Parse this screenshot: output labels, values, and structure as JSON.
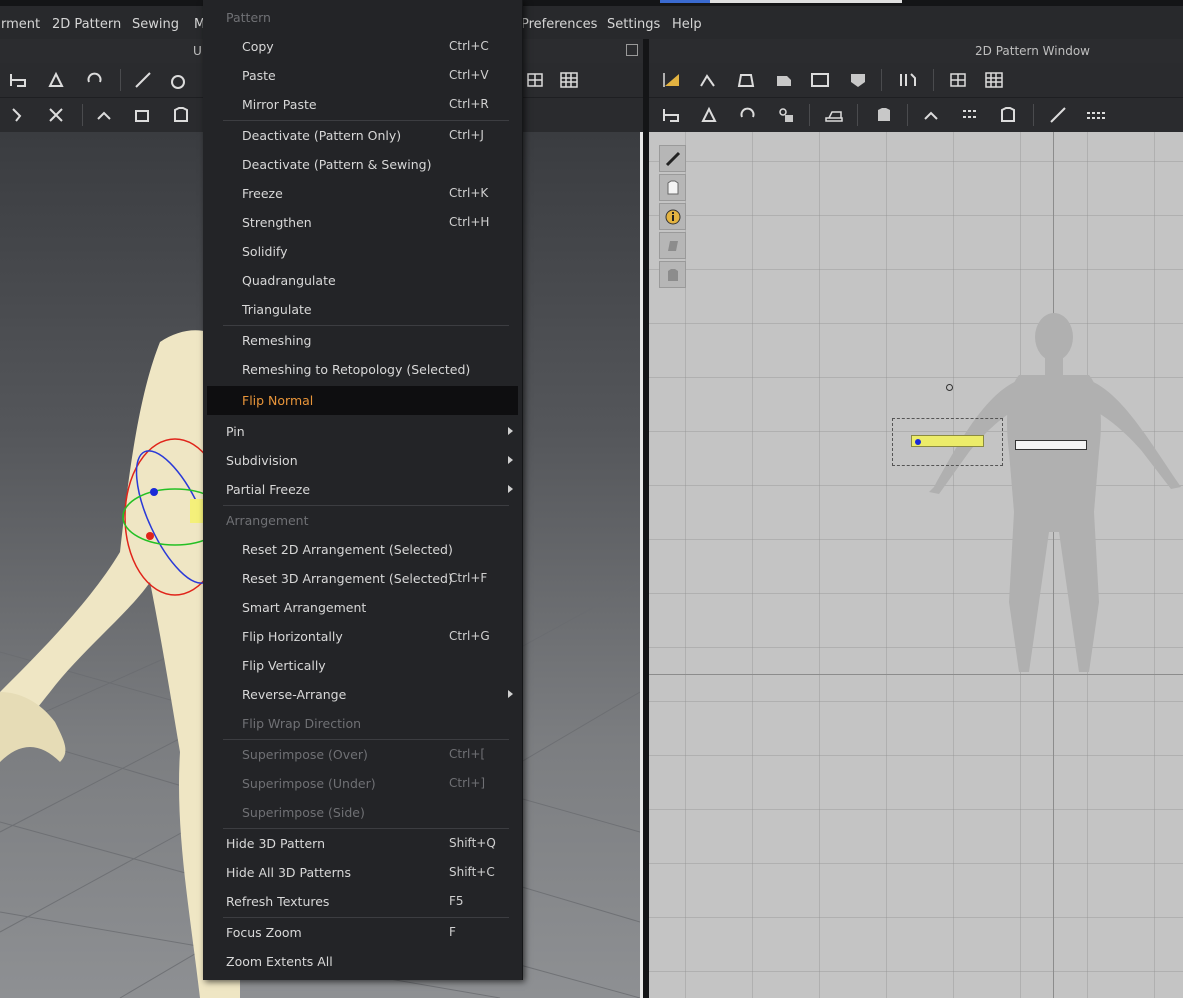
{
  "menubar": {
    "items": [
      "rment",
      "2D Pattern",
      "Sewing",
      "M",
      "Preferences",
      "Settings",
      "Help"
    ]
  },
  "panel_headers": {
    "left_title": "U",
    "right_title": "2D Pattern Window"
  },
  "context_menu": {
    "items": [
      {
        "label": "Pattern",
        "kind": "header"
      },
      {
        "label": "Copy",
        "shortcut": "Ctrl+C"
      },
      {
        "label": "Paste",
        "shortcut": "Ctrl+V"
      },
      {
        "label": "Mirror Paste",
        "shortcut": "Ctrl+R"
      },
      {
        "label": "Deactivate (Pattern Only)",
        "shortcut": "Ctrl+J"
      },
      {
        "label": "Deactivate (Pattern & Sewing)",
        "shortcut": ""
      },
      {
        "label": "Freeze",
        "shortcut": "Ctrl+K"
      },
      {
        "label": "Strengthen",
        "shortcut": "Ctrl+H"
      },
      {
        "label": "Solidify",
        "shortcut": ""
      },
      {
        "label": "Quadrangulate",
        "shortcut": ""
      },
      {
        "label": "Triangulate",
        "shortcut": ""
      },
      {
        "label": "Remeshing",
        "shortcut": ""
      },
      {
        "label": "Remeshing to Retopology (Selected)",
        "shortcut": ""
      },
      {
        "label": "Flip Normal",
        "shortcut": "",
        "kind": "active"
      },
      {
        "label": "Pin",
        "submenu": true
      },
      {
        "label": "Subdivision",
        "submenu": true
      },
      {
        "label": "Partial Freeze",
        "submenu": true
      },
      {
        "label": "Arrangement",
        "kind": "header"
      },
      {
        "label": "Reset 2D Arrangement (Selected)",
        "shortcut": ""
      },
      {
        "label": "Reset 3D Arrangement (Selected)",
        "shortcut": "Ctrl+F"
      },
      {
        "label": "Smart Arrangement",
        "shortcut": ""
      },
      {
        "label": "Flip Horizontally",
        "shortcut": "Ctrl+G"
      },
      {
        "label": "Flip Vertically",
        "shortcut": ""
      },
      {
        "label": "Reverse-Arrange",
        "submenu": true
      },
      {
        "label": "Flip Wrap Direction",
        "disabled": true
      },
      {
        "label": "Superimpose (Over)",
        "shortcut": "Ctrl+[",
        "disabled": true
      },
      {
        "label": "Superimpose (Under)",
        "shortcut": "Ctrl+]",
        "disabled": true
      },
      {
        "label": "Superimpose (Side)",
        "shortcut": "",
        "disabled": true
      },
      {
        "label": "Hide 3D Pattern",
        "shortcut": "Shift+Q"
      },
      {
        "label": "Hide All 3D Patterns",
        "shortcut": "Shift+C"
      },
      {
        "label": "Refresh Textures",
        "shortcut": "F5"
      },
      {
        "label": "Focus Zoom",
        "shortcut": "F"
      },
      {
        "label": "Zoom Extents All",
        "shortcut": ""
      }
    ]
  },
  "colors": {
    "menu_bg": "#232427",
    "active_text": "#e8953a",
    "disabled_text": "#6f7074",
    "pattern_highlight": "#ecec6a",
    "avatar_skin": "#efe6c4"
  },
  "icons": {
    "side_tools_2d": [
      "brush-icon",
      "shirt-visibility-icon",
      "info-icon",
      "fabric-icon",
      "garment-icon"
    ]
  }
}
